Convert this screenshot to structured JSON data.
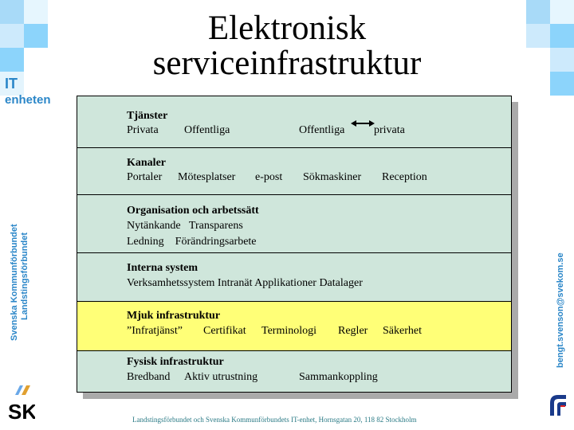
{
  "slide": {
    "title_line1": "Elektronisk",
    "title_line2": "serviceinfrastruktur",
    "brand_it": "IT",
    "brand_enheten": "enheten",
    "left_vertical_line1": "Svenska Kommunförbundet",
    "left_vertical_line2": "Landstingsförbundet",
    "right_vertical": "bengt.svenson@svekom.se",
    "footer": "Landstingsförbundet och Svenska Kommunförbundets IT-enhet, Hornsgatan 20, 118 82 Stockholm",
    "colors": {
      "brand_blue": "#2a86c8",
      "row_green": "#cfe6db",
      "row_yellow": "#ffff77",
      "shadow": "#aaaaaa"
    }
  },
  "layers": [
    {
      "heading": "Tjänster",
      "items": [
        "Privata",
        "Offentliga",
        "Offentliga",
        "privata"
      ],
      "arrow_between": "Offentliga ↔ privata"
    },
    {
      "heading": "Kanaler",
      "items": [
        "Portaler",
        "Mötesplatser",
        "e-post",
        "Sökmaskiner",
        "Reception"
      ]
    },
    {
      "heading": "Organisation och arbetssätt",
      "lines": [
        "Nytänkande   Transparens",
        "Ledning    Förändringsarbete"
      ]
    },
    {
      "heading": "Interna system",
      "line": "Verksamhetssystem Intranät Applikationer Datalager"
    },
    {
      "heading": "Mjuk infrastruktur",
      "items": [
        "”Infratjänst”",
        "Certifikat",
        "Terminologi",
        "Regler",
        "Säkerhet"
      ],
      "highlighted": true
    },
    {
      "heading": "Fysisk infrastruktur",
      "items": [
        "Bredband",
        "Aktiv utrustning",
        "Sammankoppling"
      ]
    }
  ],
  "icons": {
    "top_left": "blue-squares-decoration",
    "top_right": "blue-squares-decoration",
    "bottom_left": "sk-logo-icon",
    "bottom_right": "lf-logo-icon"
  }
}
